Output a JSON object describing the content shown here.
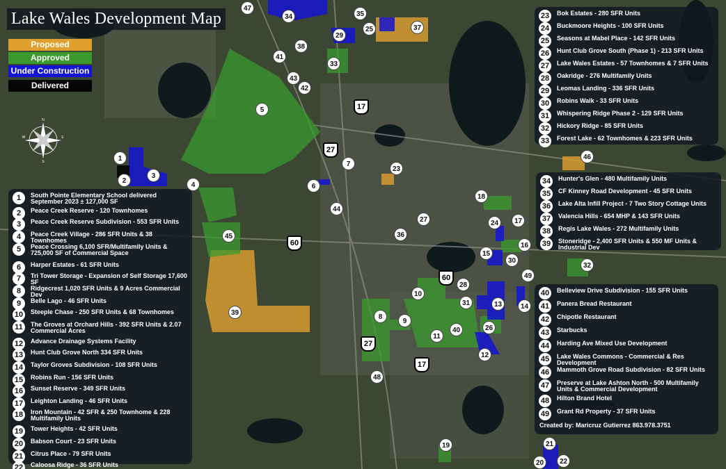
{
  "title": "Lake Wales Development Map",
  "legend": [
    {
      "label": "Proposed",
      "color": "#e0a030"
    },
    {
      "label": "Approved",
      "color": "#3a9a2e"
    },
    {
      "label": "Under Construction",
      "color": "#1414d2"
    },
    {
      "label": "Delivered",
      "color": "#050505"
    }
  ],
  "roads": {
    "us27": "27",
    "us17": "17",
    "sr60": "60"
  },
  "projects_left": [
    {
      "n": "1",
      "text": "South Pointe Elementary School delivered September 2023 ± 127,000 SF"
    },
    {
      "n": "2",
      "text": "Peace Creek Reserve - 120 Townhomes"
    },
    {
      "n": "3",
      "text": "Peace Creek Reserve Subdivision - 553 SFR Units"
    },
    {
      "n": "4",
      "text": "Peace Creek Village - 286 SFR Units & 38 Townhomes"
    },
    {
      "n": "5",
      "text": "Peace Crossing 6,100 SFR/Multifamily Units & 725,000 SF of Commercial Space"
    },
    {
      "n": "6",
      "text": "Harper Estates - 61 SFR Units"
    },
    {
      "n": "7",
      "text": "Tri Tower Storage - Expansion of Self Storage 17,600 SF"
    },
    {
      "n": "8",
      "text": "Ridgecrest 1,020 SFR Units & 9 Acres Commercial Dev"
    },
    {
      "n": "9",
      "text": "Belle Lago - 46 SFR Units"
    },
    {
      "n": "10",
      "text": "Steeple Chase - 250 SFR Units & 68 Townhomes"
    },
    {
      "n": "11",
      "text": "The Groves at Orchard Hills - 392 SFR Units & 2.07 Commercial Acres"
    },
    {
      "n": "12",
      "text": "Advance Drainage Systems Facility"
    },
    {
      "n": "13",
      "text": "Hunt Club Grove North 334 SFR Units"
    },
    {
      "n": "14",
      "text": "Taylor Groves Subdivision - 108 SFR Units"
    },
    {
      "n": "15",
      "text": "Robins Run - 156 SFR Units"
    },
    {
      "n": "16",
      "text": "Sunset Reserve - 349 SFR Units"
    },
    {
      "n": "17",
      "text": "Leighton Landing - 46 SFR Units"
    },
    {
      "n": "18",
      "text": "Iron Mountain - 42 SFR & 250 Townhome & 228 Multifamily Units"
    },
    {
      "n": "19",
      "text": "Tower Heights - 42 SFR Units"
    },
    {
      "n": "20",
      "text": "Babson Court - 23 SFR Units"
    },
    {
      "n": "21",
      "text": "Citrus Place - 79 SFR Units"
    },
    {
      "n": "22",
      "text": "Caloosa Ridge - 36 SFR Units"
    }
  ],
  "projects_right_top": [
    {
      "n": "23",
      "text": "Bok Estates - 280 SFR Units"
    },
    {
      "n": "24",
      "text": "Buckmoore Heights - 100 SFR Units"
    },
    {
      "n": "25",
      "text": "Seasons at Mabel Place - 142 SFR Units"
    },
    {
      "n": "26",
      "text": "Hunt Club Grove South (Phase 1) - 213 SFR Units"
    },
    {
      "n": "27",
      "text": "Lake Wales Estates - 57 Townhomes & 7 SFR Units"
    },
    {
      "n": "28",
      "text": "Oakridge - 276 Multifamily Units"
    },
    {
      "n": "29",
      "text": "Leomas Landing - 336 SFR Units"
    },
    {
      "n": "30",
      "text": "Robins Walk - 33 SFR Units"
    },
    {
      "n": "31",
      "text": "Whispering Ridge Phase 2 - 129 SFR Units"
    },
    {
      "n": "32",
      "text": "Hickory Ridge - 85 SFR Units"
    },
    {
      "n": "33",
      "text": "Forest Lake - 62 Townhomes & 223 SFR Units"
    }
  ],
  "projects_right_mid": [
    {
      "n": "34",
      "text": "Hunter's Glen - 480 Multifamily Units"
    },
    {
      "n": "35",
      "text": "CF Kinney Road Development - 45 SFR Units"
    },
    {
      "n": "36",
      "text": "Lake Alta Infill Project - 7 Two Story Cottage Units"
    },
    {
      "n": "37",
      "text": "Valencia Hills - 654 MHP & 143 SFR Units"
    },
    {
      "n": "38",
      "text": "Regis Lake Wales - 272 Multifamily Units"
    },
    {
      "n": "39",
      "text": "Stoneridge - 2,400 SFR Units & 550 MF Units & Industrial Dev"
    }
  ],
  "projects_right_bottom": [
    {
      "n": "40",
      "text": "Belleview Drive Subdivision - 155 SFR Units"
    },
    {
      "n": "41",
      "text": "Panera Bread Restaurant"
    },
    {
      "n": "42",
      "text": "Chipotle Restaurant"
    },
    {
      "n": "43",
      "text": "Starbucks"
    },
    {
      "n": "44",
      "text": "Harding Ave Mixed Use Development"
    },
    {
      "n": "45",
      "text": "Lake Wales Commons - Commercial & Res Development"
    },
    {
      "n": "46",
      "text": "Mammoth Grove Road Subdivision - 82 SFR Units"
    },
    {
      "n": "47",
      "text": "Preserve at Lake Ashton North - 500 Multifamily Units & Commercial Development"
    },
    {
      "n": "48",
      "text": "Hilton Brand Hotel"
    },
    {
      "n": "49",
      "text": "Grant Rd Property - 37 SFR Units"
    }
  ],
  "credit": "Created by: Maricruz Gutierrez 863.978.3751",
  "compass": {
    "n": "N",
    "s": "S",
    "e": "E",
    "w": "W"
  }
}
